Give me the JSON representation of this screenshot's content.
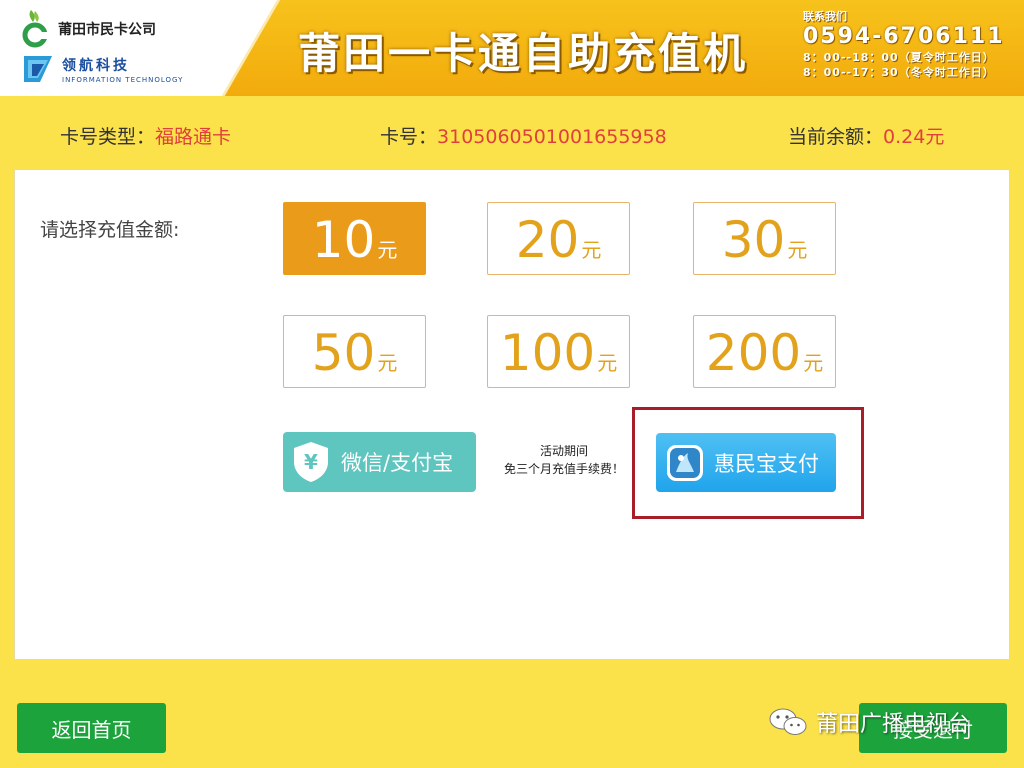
{
  "header": {
    "company_name": "莆田市民卡公司",
    "tech_name": "领航科技",
    "tech_sub": "INFORMATION TECHNOLOGY",
    "title": "莆田一卡通自助充值机",
    "contact_label": "联系我们",
    "phone": "0594-6706111",
    "hours_summer": "8：00--18：00（夏令时工作日）",
    "hours_winter": "8：00--17：30（冬令时工作日）"
  },
  "card_info": {
    "type_label": "卡号类型：",
    "type_value": "福路通卡",
    "number_label": "卡号：",
    "number_value": "3105060501001655958",
    "balance_label": "当前余额：",
    "balance_value": "0.24元"
  },
  "recharge": {
    "prompt": "请选择充值金额:",
    "unit": "元",
    "amounts": [
      "10",
      "20",
      "30",
      "50",
      "100",
      "200"
    ],
    "selected": "10"
  },
  "payment": {
    "wechat_alipay_label": "微信/支付宝",
    "promo_line1": "活动期间",
    "promo_line2": "免三个月充值手续费！",
    "huiminbao_label": "惠民宝支付"
  },
  "footer": {
    "home_label": "返回首页",
    "back_label": "接受退付",
    "watermark": "莆田广播电视台"
  },
  "colors": {
    "header_gold": "#f2ab0c",
    "selected_amount": "#eb9b1a",
    "amount_text": "#e3a21c",
    "wechat_pay": "#5fc5bf",
    "huiminbao_pay": "#20a4ec",
    "footer_green": "#1ca33b",
    "highlight_box": "#a71d28",
    "value_red": "#e0403c"
  },
  "icons": [
    "company-logo-icon",
    "tech-logo-icon",
    "yen-shield-icon",
    "huiminbao-app-icon",
    "wechat-icon"
  ]
}
